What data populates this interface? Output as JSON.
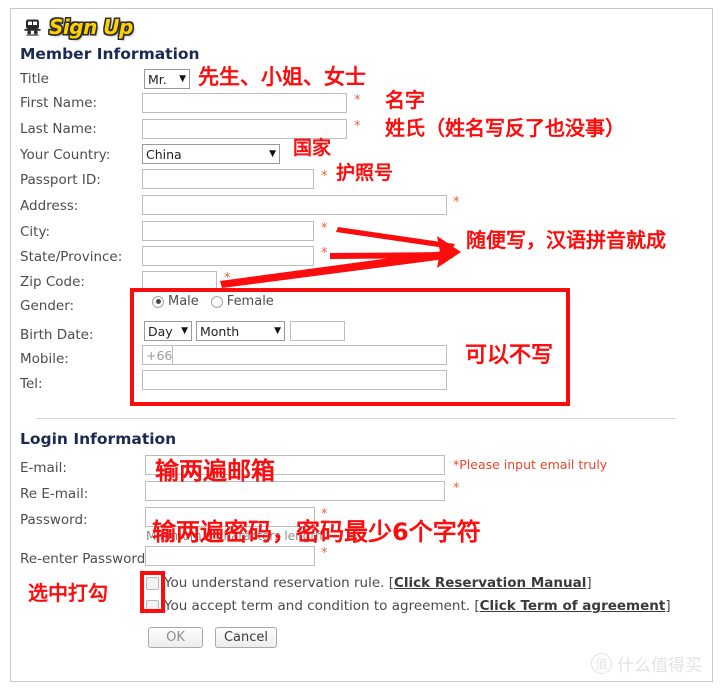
{
  "logo": {
    "icon": "train-icon",
    "text": "Sign Up"
  },
  "sections": {
    "member": "Member Information",
    "login": "Login Information"
  },
  "member_fields": {
    "title": {
      "label": "Title",
      "value": "Mr.",
      "required": false
    },
    "first_name": {
      "label": "First Name:",
      "value": "",
      "required": true
    },
    "last_name": {
      "label": "Last Name:",
      "value": "",
      "required": true
    },
    "country": {
      "label": "Your Country:",
      "value": "China",
      "required": false
    },
    "passport": {
      "label": "Passport ID:",
      "value": "",
      "required": true
    },
    "address": {
      "label": "Address:",
      "value": "",
      "required": true
    },
    "city": {
      "label": "City:",
      "value": "",
      "required": true
    },
    "state": {
      "label": "State/Province:",
      "value": "",
      "required": true
    },
    "zip": {
      "label": "Zip Code:",
      "value": "",
      "required": true
    },
    "gender": {
      "label": "Gender:",
      "options": [
        "Male",
        "Female"
      ],
      "selected": "Male"
    },
    "birth_date": {
      "label": "Birth Date:",
      "day": "Day",
      "month": "Month",
      "year": ""
    },
    "mobile": {
      "label": "Mobile:",
      "prefix": "+66",
      "value": ""
    },
    "tel": {
      "label": "Tel:",
      "value": ""
    }
  },
  "login_fields": {
    "email": {
      "label": "E-mail:",
      "value": "",
      "note": "*Please input email truly"
    },
    "re_email": {
      "label": "Re E-mail:",
      "value": "",
      "required": true
    },
    "password": {
      "label": "Password:",
      "value": "",
      "required": true,
      "hint": "Minimum 6 characters length"
    },
    "re_password": {
      "label": "Re-enter Password:",
      "value": "",
      "required": true
    }
  },
  "agreements": [
    {
      "text_before": "You understand reservation rule. [",
      "link": "Click Reservation Manual",
      "text_after": "]",
      "checked": false
    },
    {
      "text_before": "You accept term and condition to agreement. [",
      "link": "Click Term of agreement",
      "text_after": "]",
      "checked": false
    }
  ],
  "buttons": {
    "ok": "OK",
    "cancel": "Cancel"
  },
  "asterisk": "*",
  "annotations": [
    {
      "id": "title-note",
      "text": "先生、小姐、女士"
    },
    {
      "id": "first-name-note",
      "text": "名字"
    },
    {
      "id": "last-name-note",
      "text": "姓氏（姓名写反了也没事）"
    },
    {
      "id": "country-note",
      "text": "国家"
    },
    {
      "id": "passport-note",
      "text": "护照号"
    },
    {
      "id": "address-note",
      "text": "随便写，汉语拼音就成"
    },
    {
      "id": "optional-note",
      "text": "可以不写"
    },
    {
      "id": "email-note",
      "text": "输两遍邮箱"
    },
    {
      "id": "password-note",
      "text": "输两遍密码，密码最少6个字符"
    },
    {
      "id": "checkbox-note",
      "text": "选中打勾"
    }
  ],
  "watermark": {
    "mark": "值",
    "text": "什么值得买"
  },
  "colors": {
    "annotation_red": "#fc0d0d",
    "logo_yellow": "#FFD100",
    "heading_navy": "#1b2a52",
    "required_orange": "#e8603c"
  }
}
